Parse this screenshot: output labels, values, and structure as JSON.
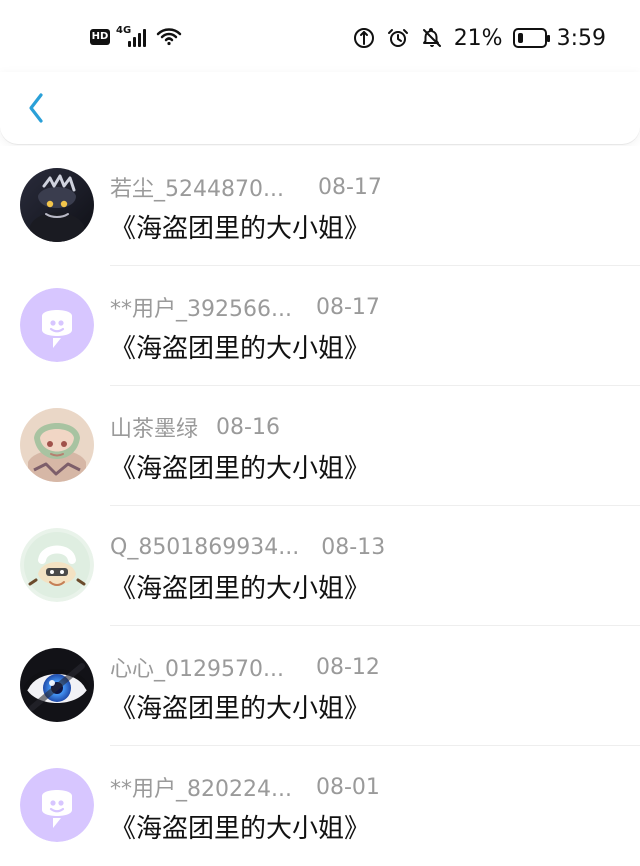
{
  "status_bar": {
    "hd": "HD",
    "net": "4G",
    "battery": "21%",
    "battery_level": 0.21,
    "time": "3:59"
  },
  "nav": {
    "back_icon": "chevron-left-icon"
  },
  "colors": {
    "accent": "#2aa0d8",
    "muted_text": "#9a9a9a",
    "placeholder_avatar": "#d7c6ff"
  },
  "list": {
    "items": [
      {
        "name": "若尘_5244870...",
        "date": "08-17",
        "title": "《海盗团里的大小姐》",
        "avatar": "anime-avatar-dark"
      },
      {
        "name": "**用户_392566...",
        "date": "08-17",
        "title": "《海盗团里的大小姐》",
        "avatar": "chat-bubble-avatar"
      },
      {
        "name": "山茶墨绿",
        "date": "08-16",
        "title": "《海盗团里的大小姐》",
        "avatar": "anime-avatar-girl"
      },
      {
        "name": "Q_8501869934...",
        "date": "08-13",
        "title": "《海盗团里的大小姐》",
        "avatar": "sticker-avatar"
      },
      {
        "name": "心心_0129570...",
        "date": "08-12",
        "title": "《海盗团里的大小姐》",
        "avatar": "eye-avatar"
      },
      {
        "name": "**用户_820224...",
        "date": "08-01",
        "title": "《海盗团里的大小姐》",
        "avatar": "chat-bubble-avatar"
      }
    ]
  }
}
